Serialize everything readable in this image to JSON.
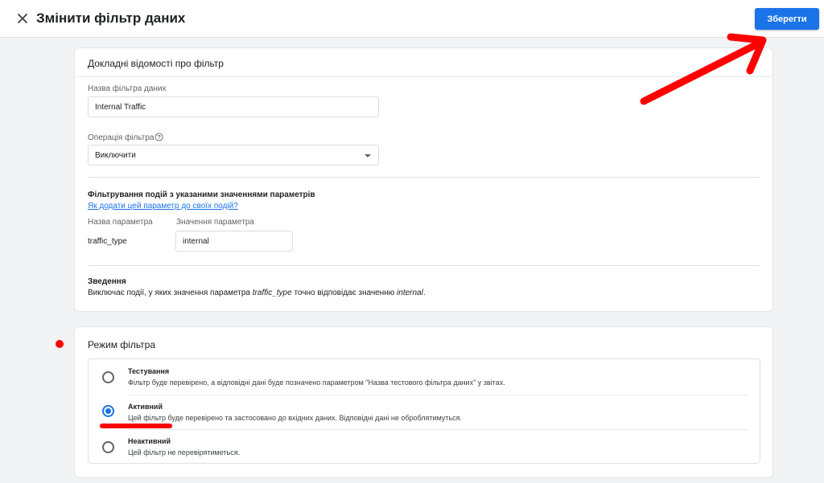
{
  "header": {
    "title": "Змінити фільтр даних",
    "save_label": "Зберегти"
  },
  "details": {
    "section_title": "Докладні відомості про фільтр",
    "filter_name_label": "Назва фільтра даних",
    "filter_name_value": "Internal Traffic",
    "operation_label": "Операція фільтра",
    "operation_value": "Виключити",
    "events_title": "Фільтрування подій з указаними значеннями параметрів",
    "events_link": "Як додати цей параметр до своїх подій?",
    "param_name_header": "Назва параметра",
    "param_value_header": "Значення параметра",
    "param_name": "traffic_type",
    "param_value": "internal",
    "summary_title": "Зведення",
    "summary_part1": "Виключає події, у яких значення параметра ",
    "summary_param": "traffic_type",
    "summary_part2": " точно відповідає значенню ",
    "summary_value": "internal",
    "summary_part3": "."
  },
  "mode": {
    "section_title": "Режим фільтра",
    "selected": "active",
    "options": [
      {
        "id": "testing",
        "title": "Тестування",
        "description": "Фільтр буде перевірено, а відповідні дані буде позначено параметром \"Назва тестового фільтра даних\" у звітах."
      },
      {
        "id": "active",
        "title": "Активний",
        "description": "Цей фільтр буде перевірено та застосовано до вхідних даних. Відповідні дані не оброблятимуться."
      },
      {
        "id": "inactive",
        "title": "Неактивний",
        "description": "Цей фільтр не перевірятиметься."
      }
    ]
  },
  "colors": {
    "accent": "#1a73e8",
    "annotation": "#ff0000",
    "background": "#f1f3f4"
  },
  "icons": {
    "close": "close-icon",
    "help": "help-circle-icon",
    "dropdown": "chevron-down-icon"
  }
}
